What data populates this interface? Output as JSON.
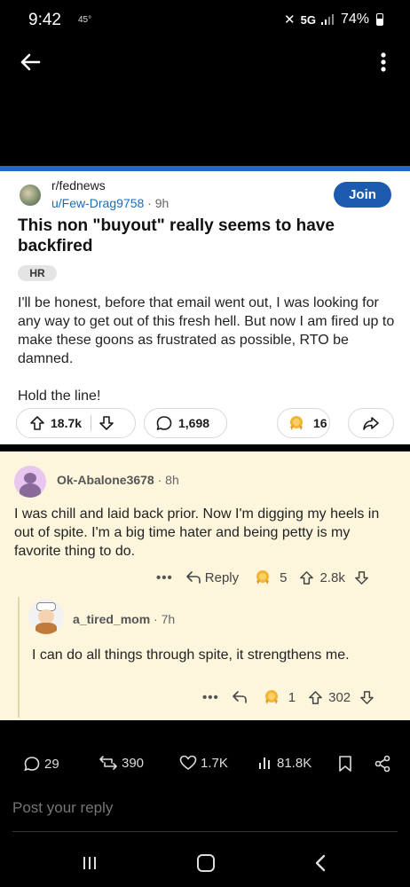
{
  "status_bar": {
    "time": "9:42",
    "temp": "45°",
    "network": "5G",
    "battery": "74%"
  },
  "post": {
    "subreddit": "r/fednews",
    "author": "u/Few-Drag9758",
    "age": "9h",
    "join_label": "Join",
    "title": "This non \"buyout\" really seems to have backfired",
    "flair": "HR",
    "body_p1": "I'll be honest, before that email went out, I was looking for any way to get out of this fresh hell. But now I am fired up to make these goons as frustrated as possible, RTO be damned.",
    "body_p2": "Hold the line!",
    "upvotes": "18.7k",
    "comments": "1,698",
    "awards": "16"
  },
  "comments": [
    {
      "author": "Ok-Abalone3678",
      "age": "8h",
      "body": "I was chill and laid back prior. Now I'm digging my heels in out of spite. I'm a big time hater and being petty is my favorite thing to do.",
      "more": "•••",
      "reply_label": "Reply",
      "awards": "5",
      "votes": "2.8k"
    },
    {
      "author": "a_tired_mom",
      "age": "7h",
      "body": "I can do all things through spite, it strengthens me.",
      "more": "•••",
      "awards": "1",
      "votes": "302"
    }
  ],
  "tweet_stats": {
    "replies": "29",
    "reposts": "390",
    "likes": "1.7K",
    "views": "81.8K"
  },
  "reply_placeholder": "Post your reply",
  "colors": {
    "accent": "#1d6cc8",
    "join": "#1c5bb0",
    "author_link": "#1a6bb8",
    "highlight_bg": "#fdf6dd"
  },
  "icons": [
    "back-arrow-icon",
    "more-vertical-icon",
    "upvote-icon",
    "downvote-icon",
    "comment-icon",
    "award-icon",
    "share-icon",
    "reply-icon",
    "repost-icon",
    "heart-icon",
    "views-icon",
    "bookmark-icon"
  ]
}
